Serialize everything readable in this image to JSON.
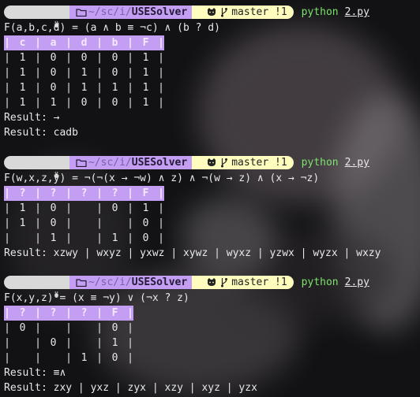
{
  "colors": {
    "os_segment": "#d9d9d9",
    "path_segment": "#c39ef2",
    "git_segment": "#fffdbd",
    "python_command": "#7be46b",
    "table_header": "#c39ef2",
    "text": "#e8e8e8"
  },
  "prompt": {
    "os_icon": "penguin-icon",
    "path_dim": "~/sc/i/",
    "path_bold": "USESolver",
    "branch": "master",
    "status": "!1",
    "command": "python",
    "file": "2.py"
  },
  "blocks": [
    {
      "formula": "F(a,b,c,d) = (a ∧ b ≡ ¬c) ∧ (b ? d)",
      "headers": [
        "c",
        "a",
        "d",
        "b",
        "F"
      ],
      "rows": [
        [
          "1",
          "0",
          "0",
          "0",
          "1"
        ],
        [
          "1",
          "0",
          "1",
          "0",
          "1"
        ],
        [
          "1",
          "0",
          "1",
          "1",
          "1"
        ],
        [
          "1",
          "1",
          "0",
          "0",
          "1"
        ]
      ],
      "result1": "Result: →",
      "result2": "Result: cadb"
    },
    {
      "formula": "F(w,x,z,y) = ¬(¬(x → ¬w) ∧ z) ∧ ¬(w → z) ∧ (x → ¬z)",
      "headers": [
        "?",
        "?",
        "?",
        "?",
        "F"
      ],
      "rows": [
        [
          "1",
          "0",
          "",
          "0",
          "1"
        ],
        [
          "1",
          "0",
          "",
          "",
          "0"
        ],
        [
          "",
          "1",
          "",
          "1",
          "0"
        ]
      ],
      "result1": "Result: xzwy | wxyz | yxwz | xywz | wyxz | yzwx | wyzx | wxzy"
    },
    {
      "formula": "F(x,y,z) = (x ≡ ¬y) ∨ (¬x ? z)",
      "headers": [
        "?",
        "?",
        "?",
        "F"
      ],
      "rows": [
        [
          "0",
          "",
          "",
          "0"
        ],
        [
          "",
          "0",
          "",
          "1"
        ],
        [
          "",
          "",
          "1",
          "0"
        ]
      ],
      "result1": "Result: ≡∧",
      "result2": "Result: zxy | yxz | zyx | xzy | xyz | yzx"
    }
  ]
}
